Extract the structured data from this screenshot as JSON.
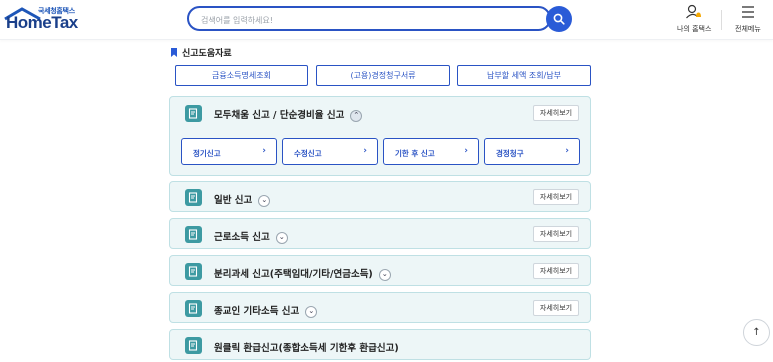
{
  "header": {
    "logo_small": "국세청홈택스",
    "logo_main": "HomeTax",
    "search_placeholder": "검색어를 입력하세요!",
    "my_hometax": "나의 홈택스",
    "all_menu": "전체메뉴"
  },
  "section": {
    "title": "신고도움자료",
    "top_buttons": [
      "금융소득명세조회",
      "(고용)경정청구서류",
      "납부할 세액 조회/납부"
    ]
  },
  "cards": [
    {
      "title": "모두채움 신고 / 단순경비율 신고",
      "detail": "자세히보기",
      "expanded": true,
      "sub_buttons": [
        "정기신고",
        "수정신고",
        "기한 후 신고",
        "경정청구"
      ]
    },
    {
      "title": "일반 신고",
      "detail": "자세히보기"
    },
    {
      "title": "근로소득 신고",
      "detail": "자세히보기"
    },
    {
      "title": "분리과세 신고(주택임대/기타/연금소득)",
      "detail": "자세히보기"
    },
    {
      "title": "종교인 기타소득 신고",
      "detail": "자세히보기"
    },
    {
      "title": "원클릭 환급신고(종합소득세 기한후 환급신고)"
    }
  ],
  "colors": {
    "accent": "#2a53c4",
    "card_bg": "#edf6f7",
    "card_icon": "#3d9aa2"
  },
  "icons": {
    "search": "search-icon",
    "user": "user-bell-icon",
    "menu": "hamburger-icon",
    "top": "arrow-up-icon"
  }
}
